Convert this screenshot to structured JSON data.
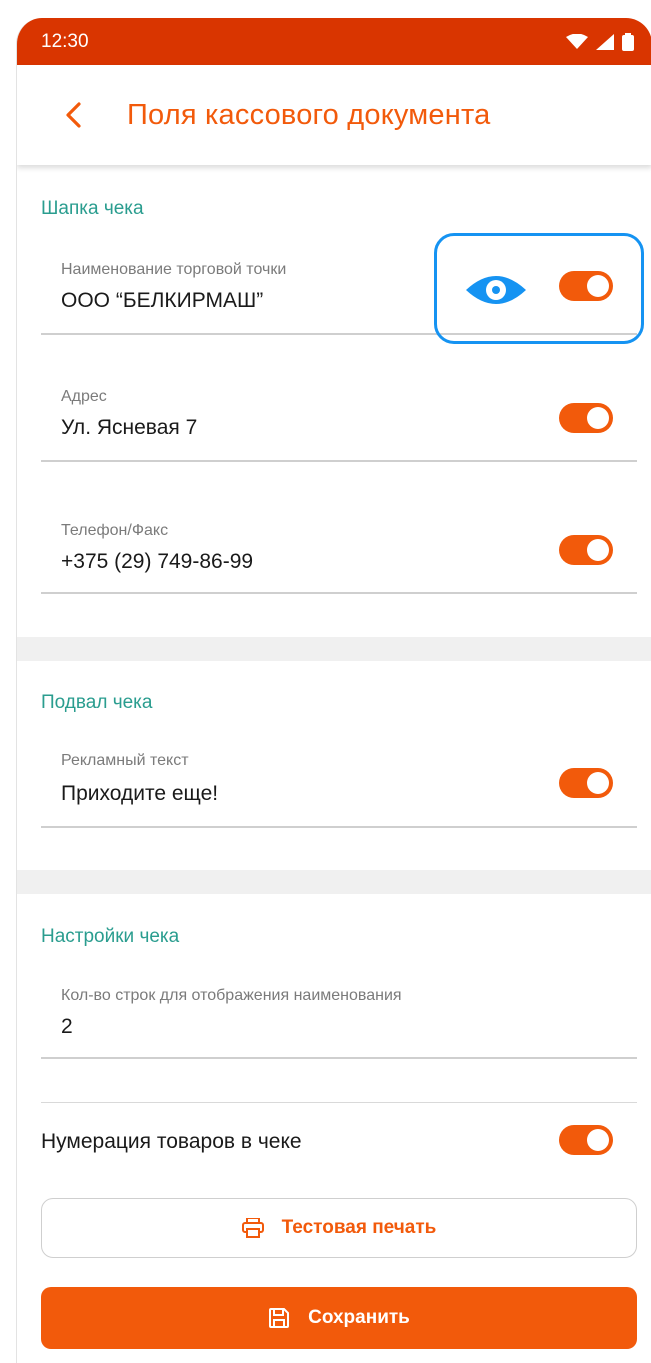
{
  "status_bar": {
    "time": "12:30"
  },
  "app_bar": {
    "title": "Поля кассового документа"
  },
  "sections": {
    "header": {
      "title": "Шапка чека",
      "fields": [
        {
          "label": "Наименование торговой точки",
          "value": "ООО “БЕЛКИРМАШ”",
          "visible": true
        },
        {
          "label": "Адрес",
          "value": "Ул. Ясневая 7",
          "visible": true
        },
        {
          "label": "Телефон/Факс",
          "value": "+375 (29) 749-86-99",
          "visible": true
        }
      ]
    },
    "footer": {
      "title": "Подвал чека",
      "fields": [
        {
          "label": "Рекламный текст",
          "value": "Приходите еще!",
          "visible": true
        }
      ]
    },
    "settings": {
      "title": "Настройки чека",
      "lines_field": {
        "label": "Кол-во строк для отображения наименования",
        "value": "2"
      },
      "numbering": {
        "label": "Нумерация товаров в чеке",
        "enabled": true
      }
    }
  },
  "buttons": {
    "test_print": "Тестовая печать",
    "save": "Сохранить"
  },
  "colors": {
    "accent": "#f25a0b",
    "status_bar": "#d93500",
    "section_title": "#2a9d8f",
    "highlight": "#1593f2"
  },
  "icons": [
    "back-arrow-icon",
    "wifi-icon",
    "signal-icon",
    "battery-icon",
    "eye-icon",
    "printer-icon",
    "save-icon"
  ]
}
